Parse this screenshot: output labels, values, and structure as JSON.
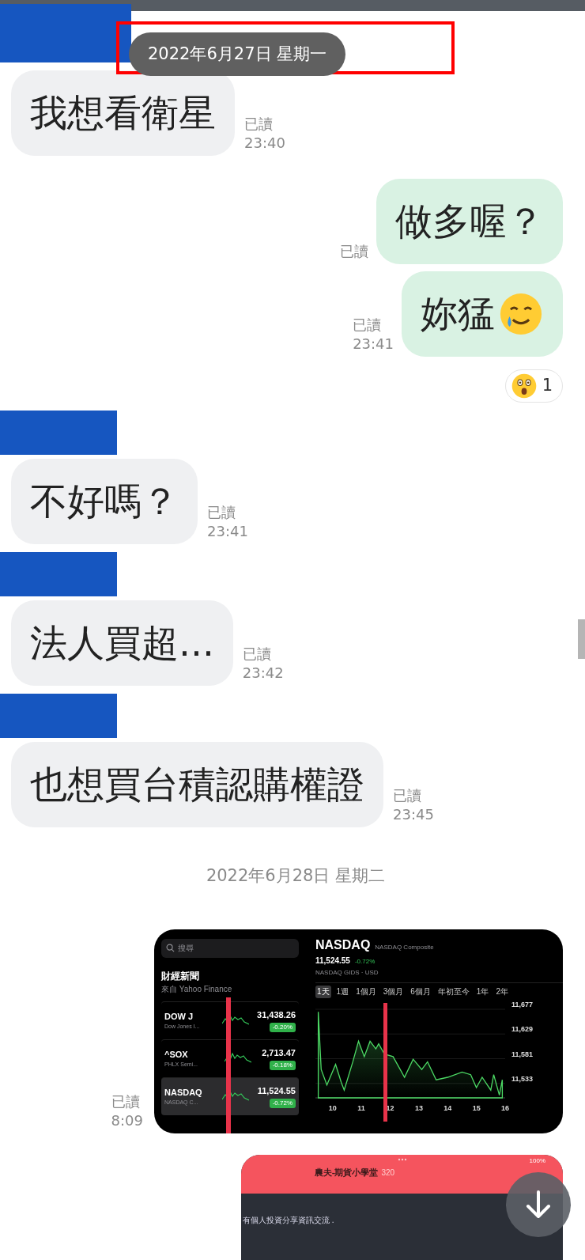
{
  "top_date": {
    "label": "2022年6月27日 星期一",
    "highlighted": true
  },
  "messages": [
    {
      "kind": "redaction"
    },
    {
      "kind": "text",
      "outgoing": false,
      "text": "我想看衛星",
      "read": "已讀",
      "time": "23:40"
    },
    {
      "kind": "text",
      "outgoing": true,
      "text": "做多喔？",
      "read": "已讀"
    },
    {
      "kind": "text",
      "outgoing": true,
      "text": "妳猛",
      "has_emoji": true,
      "read": "已讀",
      "time": "23:41",
      "reaction": {
        "count": "1"
      }
    },
    {
      "kind": "redaction"
    },
    {
      "kind": "text",
      "outgoing": false,
      "text": "不好嗎？",
      "read": "已讀",
      "time": "23:41"
    },
    {
      "kind": "redaction"
    },
    {
      "kind": "text",
      "outgoing": false,
      "text": "法人買超...",
      "read": "已讀",
      "time": "23:42"
    },
    {
      "kind": "redaction"
    },
    {
      "kind": "text",
      "outgoing": false,
      "text": "也想買台積認購權證",
      "read": "已讀",
      "time": "23:45"
    },
    {
      "kind": "date",
      "label": "2022年6月28日 星期二"
    },
    {
      "kind": "stocks_image",
      "read": "已讀",
      "time": "8:09"
    },
    {
      "kind": "group_image"
    }
  ],
  "stocks_screenshot": {
    "search_placeholder": "搜尋",
    "news_title": "財經新聞",
    "news_source": "來自 Yahoo Finance",
    "stocks": [
      {
        "symbol": "DOW J",
        "name": "Dow Jones I...",
        "price": "31,438.26",
        "change": "-0.20%",
        "selected": false
      },
      {
        "symbol": "^SOX",
        "name": "PHLX Semi...",
        "price": "2,713.47",
        "change": "-0.18%",
        "selected": false
      },
      {
        "symbol": "NASDAQ",
        "name": "NASDAQ C...",
        "price": "11,524.55",
        "change": "-0.72%",
        "selected": true
      }
    ],
    "detail": {
      "symbol": "NASDAQ",
      "full_name": "NASDAQ Composite",
      "price": "11,524.55",
      "change": "-0.72%",
      "exchange": "NASDAQ GIDS · USD",
      "ranges": [
        {
          "label": "1天",
          "selected": true
        },
        {
          "label": "1週",
          "selected": false
        },
        {
          "label": "1個月",
          "selected": false
        },
        {
          "label": "3個月",
          "selected": false
        },
        {
          "label": "6個月",
          "selected": false
        },
        {
          "label": "年初至今",
          "selected": false
        },
        {
          "label": "1年",
          "selected": false
        },
        {
          "label": "2年",
          "selected": false
        }
      ],
      "chart_data": {
        "type": "area",
        "x": [
          9.5,
          9.6,
          9.8,
          10.1,
          10.3,
          10.4,
          10.7,
          10.9,
          11.1,
          11.3,
          11.5,
          11.6,
          11.8,
          12.1,
          12.5,
          12.8,
          13.1,
          13.3,
          13.6,
          14.0,
          14.5,
          14.8,
          15.0,
          15.2,
          15.5,
          15.6,
          15.8,
          15.9
        ],
        "grid": true,
        "series": [
          {
            "color": "#4cd964",
            "values": [
              11672,
              11560,
              11530,
              11570,
              11535,
              11520,
              11575,
              11615,
              11585,
              11615,
              11600,
              11610,
              11590,
              11585,
              11545,
              11580,
              11560,
              11575,
              11540,
              11545,
              11555,
              11550,
              11525,
              11545,
              11520,
              11550,
              11510,
              11540
            ]
          }
        ],
        "xlim": [
          9.4,
          16
        ],
        "ylim": [
          11505,
          11677
        ],
        "xticks": [
          10,
          11,
          12,
          13,
          14,
          15,
          16
        ],
        "yticks": [
          {
            "value": 11533,
            "label": "11,533"
          },
          {
            "value": 11581,
            "label": "11,581"
          },
          {
            "value": 11629,
            "label": "11,629"
          },
          {
            "value": 11677,
            "label": "11,677"
          }
        ]
      }
    }
  },
  "group_screenshot": {
    "status": "100%",
    "title": "農夫-期貨小學堂",
    "member_count": "320",
    "description": "有個人投資分享資訊交流 ."
  }
}
